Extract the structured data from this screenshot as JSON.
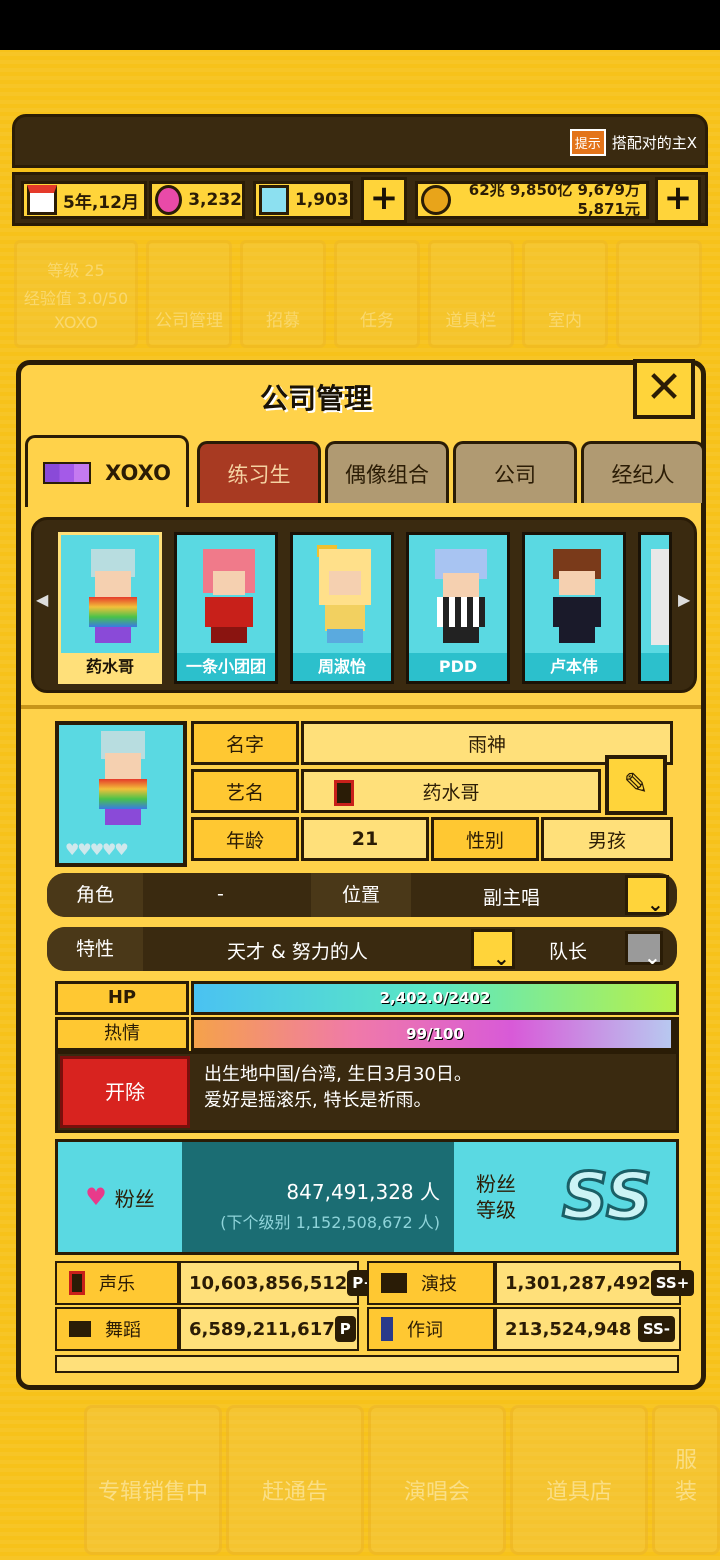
{
  "hint": {
    "badge": "提示",
    "text": "搭配对的主X"
  },
  "resources": {
    "date": "5年,12月",
    "gems_pink": "3,232",
    "gems_blue": "1,903",
    "money_line1": "62兆 9,850亿 9,679万",
    "money_line2": "5,871元"
  },
  "bg_menu": {
    "level_label": "等级",
    "level_value": "25",
    "exp_label": "经验值 3.0/50",
    "group_name": "XOXO",
    "items": [
      "公司管理",
      "招募",
      "任务",
      "道具栏",
      "室内"
    ]
  },
  "panel": {
    "title": "公司管理",
    "close": "✕"
  },
  "tabs": [
    {
      "label": "XOXO"
    },
    {
      "label": "练习生"
    },
    {
      "label": "偶像组合"
    },
    {
      "label": "公司"
    },
    {
      "label": "经纪人"
    }
  ],
  "roster": [
    {
      "name": "药水哥",
      "hair": "#b8dde0"
    },
    {
      "name": "一条小团团",
      "hair": "#f07a8a"
    },
    {
      "name": "周淑怡",
      "hair": "#ffe08a"
    },
    {
      "name": "PDD",
      "hair": "#a8c4f2"
    },
    {
      "name": "卢本伟",
      "hair": "#7a3a1a"
    }
  ],
  "profile": {
    "name_label": "名字",
    "name_value": "雨神",
    "stage_label": "艺名",
    "stage_value": "药水哥",
    "age_label": "年龄",
    "age_value": "21",
    "gender_label": "性别",
    "gender_value": "男孩",
    "hearts": "♥♥♥♥♥"
  },
  "role": {
    "label": "角色",
    "value": "-",
    "pos_label": "位置",
    "pos_value": "副主唱"
  },
  "trait": {
    "label": "特性",
    "value": "天才 & 努力的人",
    "leader_label": "队长"
  },
  "hp": {
    "label": "HP",
    "text": "2,402.0/2402",
    "fraction": 1.0
  },
  "passion": {
    "label": "热情",
    "text": "99/100",
    "fraction": 0.99
  },
  "fire_button": "开除",
  "bio": {
    "line1": "出生地中国/台湾, 生日3月30日。",
    "line2": "爱好是摇滚乐, 特长是祈雨。"
  },
  "fans": {
    "label": "粉丝",
    "count": "847,491,328 人",
    "next": "(下个级别 1,152,508,672 人)",
    "grade_label_1": "粉丝",
    "grade_label_2": "等级",
    "grade": "SS"
  },
  "stats": [
    {
      "name": "声乐",
      "value": "10,603,856,512",
      "rank": "P+"
    },
    {
      "name": "演技",
      "value": "1,301,287,492",
      "rank": "SS+"
    },
    {
      "name": "舞蹈",
      "value": "6,589,211,617",
      "rank": "P"
    },
    {
      "name": "作词",
      "value": "213,524,948",
      "rank": "SS-"
    }
  ],
  "bottom_nav": [
    "专辑销售中",
    "赶通告",
    "演唱会",
    "道具店",
    "服装"
  ],
  "colors": {
    "accent": "#ffd43a",
    "dark": "#2a1c06",
    "cyan": "#5ad9e2",
    "fire": "#d8231f"
  }
}
